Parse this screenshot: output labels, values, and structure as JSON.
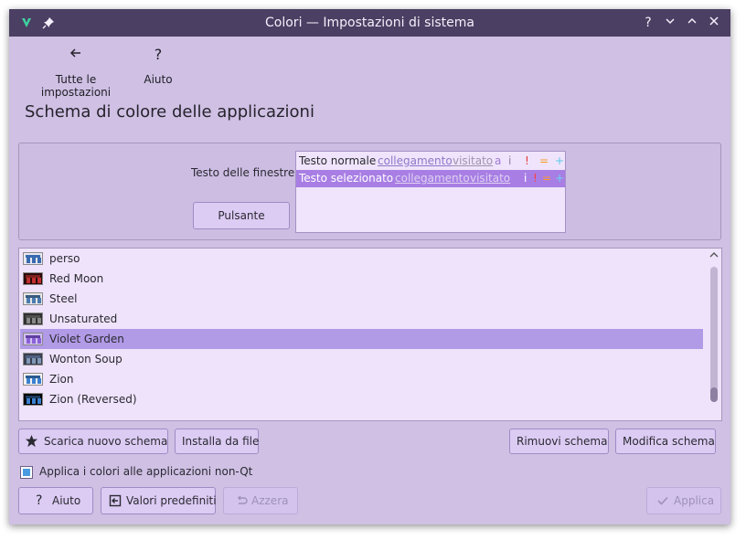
{
  "window": {
    "title": "Colori — Impostazioni di sistema",
    "buttons": {
      "help": "?",
      "minimize": "⌵",
      "maximize": "⌃",
      "close": "✕"
    }
  },
  "toolbar": {
    "back_label": "Tutte le impostazioni",
    "help_label": "Aiuto"
  },
  "page_title": "Schema di colore delle applicazioni",
  "preview": {
    "window_text_label": "Testo delle finestre",
    "button_label": "Pulsante",
    "normal_row": {
      "text": "Testo normale",
      "link": "collegamento",
      "visited": "visitato",
      "extra": [
        "a",
        "i",
        "!",
        "=",
        "+"
      ],
      "extra_colors": [
        "#a07ad8",
        "#8b84a8",
        "#e23a3a",
        "#f39a28",
        "#5cc8e8"
      ]
    },
    "selected_row": {
      "text": "Testo selezionato",
      "link": "collegamento",
      "visited": "visitato",
      "extra": [
        "i",
        "!",
        "=",
        "+"
      ],
      "extra_colors": [
        "#ffffff",
        "#ff4040",
        "#ff9a28",
        "#6ad6f0"
      ]
    }
  },
  "schemes": {
    "items": [
      {
        "name": "perso",
        "colors": [
          "#e8e8f0",
          "#3a6ab0",
          "#3a6ab0"
        ]
      },
      {
        "name": "Red Moon",
        "colors": [
          "#2a0a0a",
          "#c03030",
          "#802020"
        ]
      },
      {
        "name": "Steel",
        "colors": [
          "#e6e6e6",
          "#4a7ab0",
          "#3a5a80"
        ]
      },
      {
        "name": "Unsaturated",
        "colors": [
          "#303030",
          "#888888",
          "#505050"
        ]
      },
      {
        "name": "Violet Garden",
        "colors": [
          "#d0c0f0",
          "#8a60d8",
          "#6040a0"
        ]
      },
      {
        "name": "Wonton Soup",
        "colors": [
          "#3a4050",
          "#8098b8",
          "#506080"
        ]
      },
      {
        "name": "Zion",
        "colors": [
          "#f2f2f2",
          "#3a80d0",
          "#2a5a90"
        ]
      },
      {
        "name": "Zion (Reversed)",
        "colors": [
          "#000000",
          "#3a80d0",
          "#1a3a60"
        ]
      }
    ],
    "selected_index": 4,
    "scroll_up": "⌃"
  },
  "actions": {
    "download_label": "Scarica nuovo schema",
    "install_label": "Installa da file",
    "remove_label": "Rimuovi schema",
    "edit_label": "Modifica schema"
  },
  "apply_non_qt": {
    "label": "Applica i colori alle applicazioni non-Qt",
    "checked": true
  },
  "footer": {
    "help_label": "Aiuto",
    "defaults_label": "Valori predefiniti",
    "reset_label": "Azzera",
    "apply_label": "Applica"
  },
  "icons": {
    "app": "palette-icon",
    "pin": "pin-icon",
    "back": "arrow-left-icon",
    "help": "question-icon",
    "star": "star-icon",
    "defaults": "defaults-icon",
    "undo": "undo-icon",
    "check": "check-icon"
  }
}
